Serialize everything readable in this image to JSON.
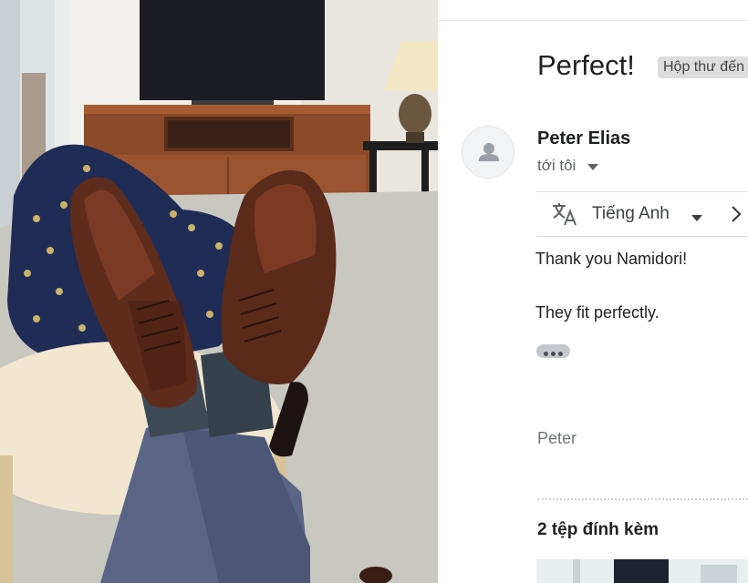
{
  "photo": {
    "subject": "brown leather oxford shoes resting on a stool"
  },
  "email": {
    "subject": "Perfect!",
    "label": "Hộp thư đến",
    "sender_name": "Peter Elias",
    "recipient": "tới tôi",
    "translate": {
      "language": "Tiếng Anh",
      "icon": "translate-icon"
    },
    "body_lines": [
      "Thank you Namidori!",
      "They fit perfectly."
    ],
    "signature": "Peter",
    "attachments_title": "2 tệp đính kèm"
  },
  "colors": {
    "label_chip_bg": "#dddddd",
    "text_primary": "#202124",
    "text_secondary": "#5f6368"
  }
}
